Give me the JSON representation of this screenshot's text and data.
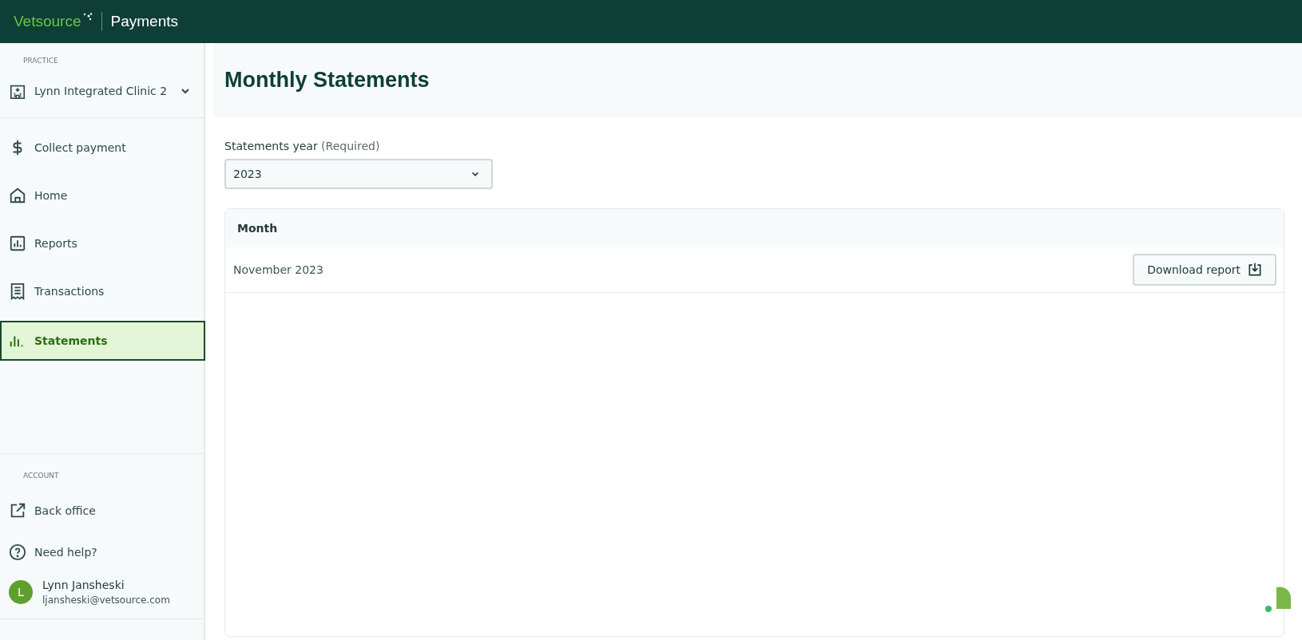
{
  "header": {
    "brand": "Vetsource",
    "product": "Payments"
  },
  "sidebar": {
    "practice_label": "PRACTICE",
    "practice": {
      "name": "Lynn Integrated Clinic 2",
      "expanded": false
    },
    "items": [
      {
        "label": "Collect payment",
        "selected": false
      },
      {
        "label": "Home",
        "selected": false
      },
      {
        "label": "Reports",
        "selected": false
      },
      {
        "label": "Transactions",
        "selected": false
      },
      {
        "label": "Statements",
        "selected": true
      }
    ],
    "account_label": "ACCOUNT",
    "account_items": [
      {
        "label": "Back office"
      },
      {
        "label": "Need help?"
      }
    ],
    "user": {
      "initial": "L",
      "name": "Lynn Jansheski",
      "email": "ljansheski@vetsource.com"
    }
  },
  "page": {
    "title": "Monthly Statements",
    "year_field": {
      "label": "Statements year",
      "hint": "(Required)",
      "value": "2023"
    },
    "table": {
      "columns": [
        "Month"
      ],
      "rows": [
        {
          "month": "November 2023",
          "action": "Download report"
        }
      ]
    }
  }
}
